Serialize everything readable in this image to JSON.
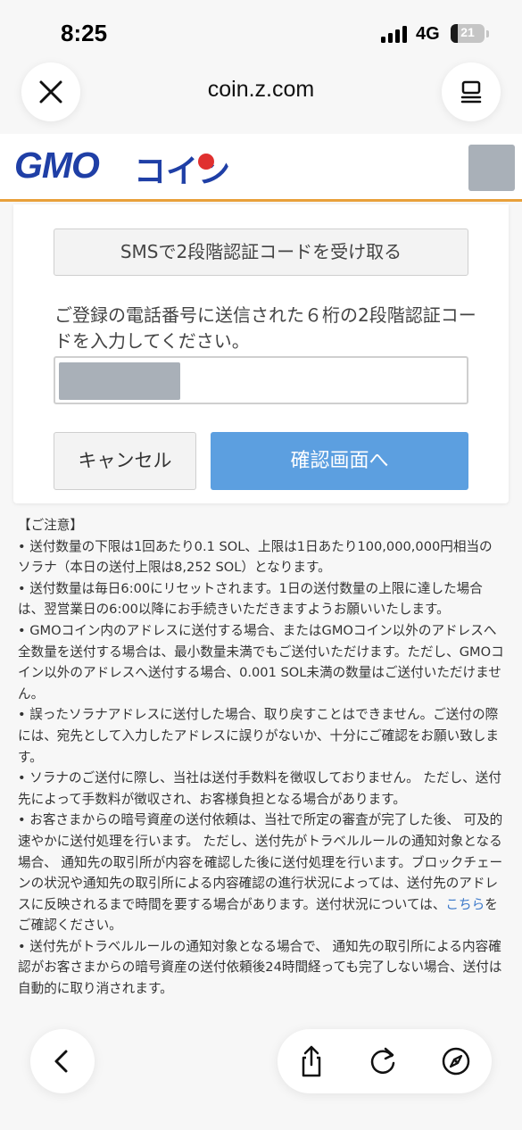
{
  "status_bar": {
    "time": "8:25",
    "network": "4G",
    "battery": "21",
    "battery_level": 0.21
  },
  "browser": {
    "url": "coin.z.com",
    "close_icon": "close-icon",
    "tabs_icon": "tabs-icon"
  },
  "site": {
    "logo_latin": "GMO",
    "logo_kana": "コイン"
  },
  "form": {
    "sms_button": "SMSで2段階認証コードを受け取る",
    "instruction": "ご登録の電話番号に送信された６桁の2段階認証コードを入力してください。",
    "code_value": "",
    "cancel_button": "キャンセル",
    "confirm_button": "確認画面へ"
  },
  "notes": {
    "heading": "【ご注意】",
    "n1": "• 送付数量の下限は1回あたり0.1 SOL、上限は1日あたり100,000,000円相当のソラナ（本日の送付上限は8,252 SOL）となります。",
    "n2": "• 送付数量は毎日6:00にリセットされます。1日の送付数量の上限に達した場合は、翌営業日の6:00以降にお手続きいただきますようお願いいたします。",
    "n3": "• GMOコイン内のアドレスに送付する場合、またはGMOコイン以外のアドレスへ全数量を送付する場合は、最小数量未満でもご送付いただけます。ただし、GMOコイン以外のアドレスへ送付する場合、0.001 SOL未満の数量はご送付いただけません。",
    "n4": "• 誤ったソラナアドレスに送付した場合、取り戻すことはできません。ご送付の際には、宛先として入力したアドレスに誤りがないか、十分にご確認をお願い致します。",
    "n5": "• ソラナのご送付に際し、当社は送付手数料を徴収しておりません。 ただし、送付先によって手数料が徴収され、お客様負担となる場合があります。",
    "n6_pre": "• お客さまからの暗号資産の送付依頼は、当社で所定の審査が完了した後、 可及的速やかに送付処理を行います。 ただし、送付先がトラベルルールの通知対象となる場合、 通知先の取引所が内容を確認した後に送付処理を行います。ブロックチェーンの状況や通知先の取引所による内容確認の進行状況によっては、送付先のアドレスに反映されるまで時間を要する場合があります。送付状況については、",
    "n6_link": "こちら",
    "n6_post": "をご確認ください。",
    "n7": "• 送付先がトラベルルールの通知対象となる場合で、 通知先の取引所による内容確認がお客さまからの暗号資産の送付依頼後24時間経っても完了しない場合、送付は自動的に取り消されます。"
  },
  "toolbar": {
    "back_icon": "back-icon",
    "share_icon": "share-icon",
    "reload_icon": "reload-icon",
    "compass_icon": "compass-icon"
  }
}
